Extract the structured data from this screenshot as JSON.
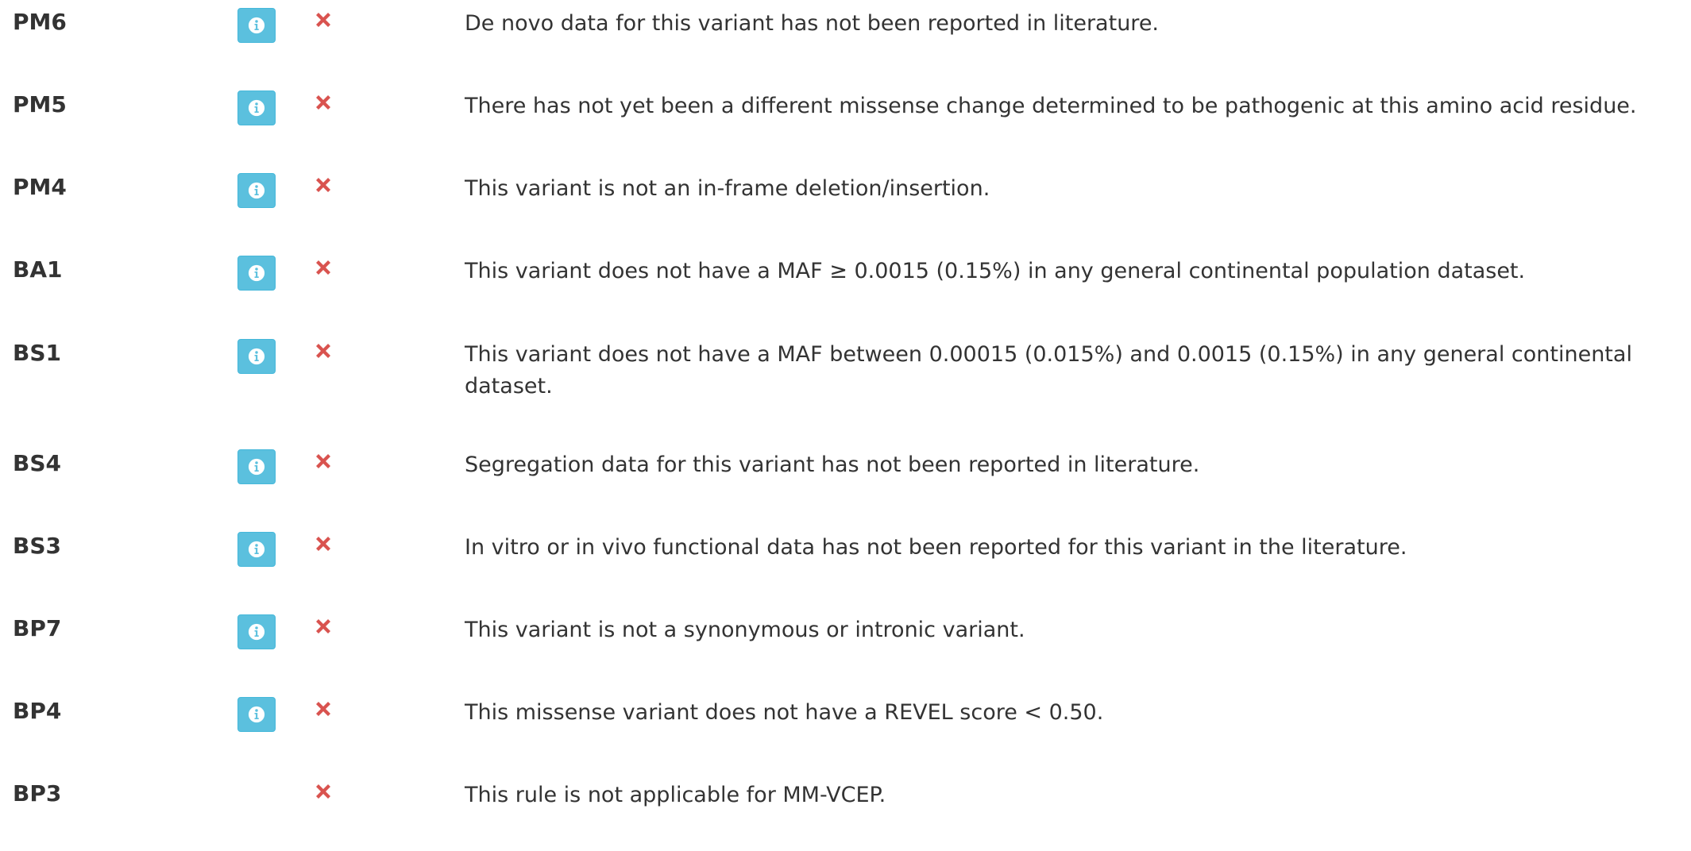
{
  "colors": {
    "info_button": "#5bc0de",
    "fail_mark": "#d9534f",
    "text": "#333333"
  },
  "icons": {
    "info": "info-circle-icon",
    "status": "x-mark-icon"
  },
  "criteria": [
    {
      "code": "PM6",
      "has_info": true,
      "met": false,
      "description": "De novo data for this variant has not been reported in literature."
    },
    {
      "code": "PM5",
      "has_info": true,
      "met": false,
      "description": "There has not yet been a different missense change determined to be pathogenic at this amino acid residue."
    },
    {
      "code": "PM4",
      "has_info": true,
      "met": false,
      "description": "This variant is not an in-frame deletion/insertion."
    },
    {
      "code": "BA1",
      "has_info": true,
      "met": false,
      "description": "This variant does not have a MAF ≥ 0.0015 (0.15%) in any general continental population dataset."
    },
    {
      "code": "BS1",
      "has_info": true,
      "met": false,
      "description": "This variant does not have a MAF between 0.00015 (0.015%) and 0.0015 (0.15%) in any general continental dataset."
    },
    {
      "code": "BS4",
      "has_info": true,
      "met": false,
      "description": "Segregation data for this variant has not been reported in literature."
    },
    {
      "code": "BS3",
      "has_info": true,
      "met": false,
      "description": "In vitro or in vivo functional data has not been reported for this variant in the literature."
    },
    {
      "code": "BP7",
      "has_info": true,
      "met": false,
      "description": "This variant is not a synonymous or intronic variant."
    },
    {
      "code": "BP4",
      "has_info": true,
      "met": false,
      "description": "This missense variant does not have a REVEL score < 0.50."
    },
    {
      "code": "BP3",
      "has_info": false,
      "met": false,
      "description": "This rule is not applicable for MM-VCEP."
    }
  ]
}
